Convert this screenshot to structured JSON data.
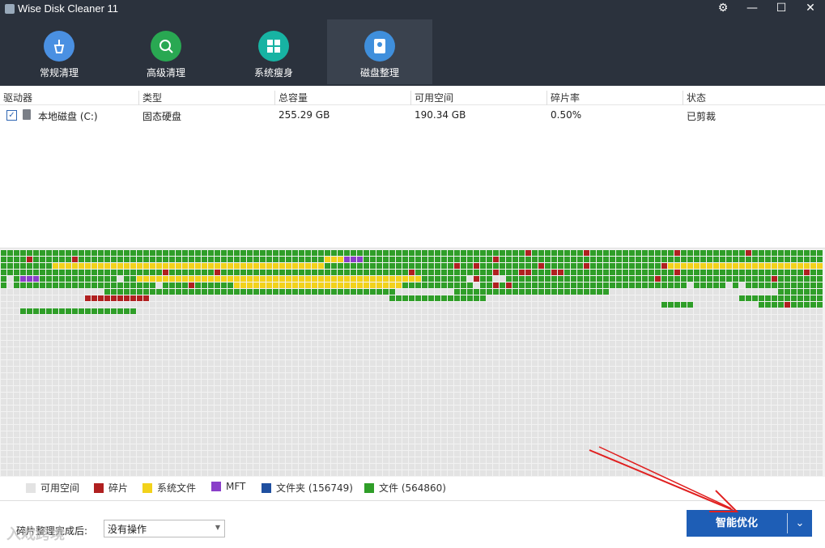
{
  "app": {
    "title": "Wise Disk Cleaner 11"
  },
  "window_controls": {
    "settings": "⚙",
    "minimize": "—",
    "maximize": "☐",
    "close": "✕"
  },
  "tabs": [
    {
      "label": "常规清理",
      "icon": "broom-icon",
      "color": "#4a90e2"
    },
    {
      "label": "高级清理",
      "icon": "disk-search-icon",
      "color": "#29a852"
    },
    {
      "label": "系统瘦身",
      "icon": "windows-icon",
      "color": "#17b3a3"
    },
    {
      "label": "磁盘整理",
      "icon": "defrag-icon",
      "color": "#3f8fdc",
      "active": true
    }
  ],
  "columns": [
    "驱动器",
    "类型",
    "总容量",
    "可用空间",
    "碎片率",
    "状态"
  ],
  "drives": [
    {
      "checked": true,
      "name": "本地磁盘 (C:)",
      "type": "固态硬盘",
      "total": "255.29 GB",
      "free": "190.34 GB",
      "frag": "0.50%",
      "status": "已剪裁"
    }
  ],
  "legend": [
    {
      "label": "可用空间",
      "color": "#e3e3e3"
    },
    {
      "label": "碎片",
      "color": "#b02020"
    },
    {
      "label": "系统文件",
      "color": "#f2d21b"
    },
    {
      "label": "MFT",
      "color": "#8a3fc9"
    },
    {
      "label": "文件夹 (156749)",
      "color": "#1f4fa0"
    },
    {
      "label": "文件 (564860)",
      "color": "#2f9e28"
    }
  ],
  "bottom": {
    "after_label": "碎片整理完成后:",
    "after_value": "没有操作",
    "primary_label": "智能优化",
    "dropdown_icon": "⌄"
  },
  "watermark": "入戏跨境"
}
